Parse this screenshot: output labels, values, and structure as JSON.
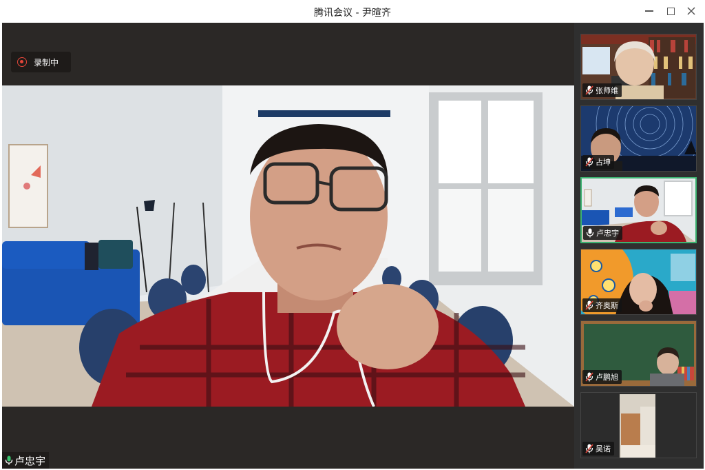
{
  "window": {
    "title": "腾讯会议 - 尹暄齐"
  },
  "recording": {
    "label": "录制中",
    "color": "#e3463a"
  },
  "main_video": {
    "speaker_name": "卢忠宇",
    "mic_state": "on"
  },
  "participants": [
    {
      "name": "张师维",
      "mic_state": "muted",
      "active": false,
      "background": "bookshelf"
    },
    {
      "name": "占坤",
      "mic_state": "muted",
      "active": false,
      "background": "star-trails"
    },
    {
      "name": "卢忠宇",
      "mic_state": "on",
      "active": true,
      "background": "office-room"
    },
    {
      "name": "齐奥斯",
      "mic_state": "muted",
      "active": false,
      "background": "cartoon"
    },
    {
      "name": "卢鹏旭",
      "mic_state": "muted",
      "active": false,
      "background": "chalkboard"
    },
    {
      "name": "吴诺",
      "mic_state": "muted",
      "active": false,
      "background": "dark-room"
    }
  ],
  "colors": {
    "active_border": "#3cb371",
    "muted_mic": "#e3463a",
    "panel_bg": "#2f2f2f"
  }
}
